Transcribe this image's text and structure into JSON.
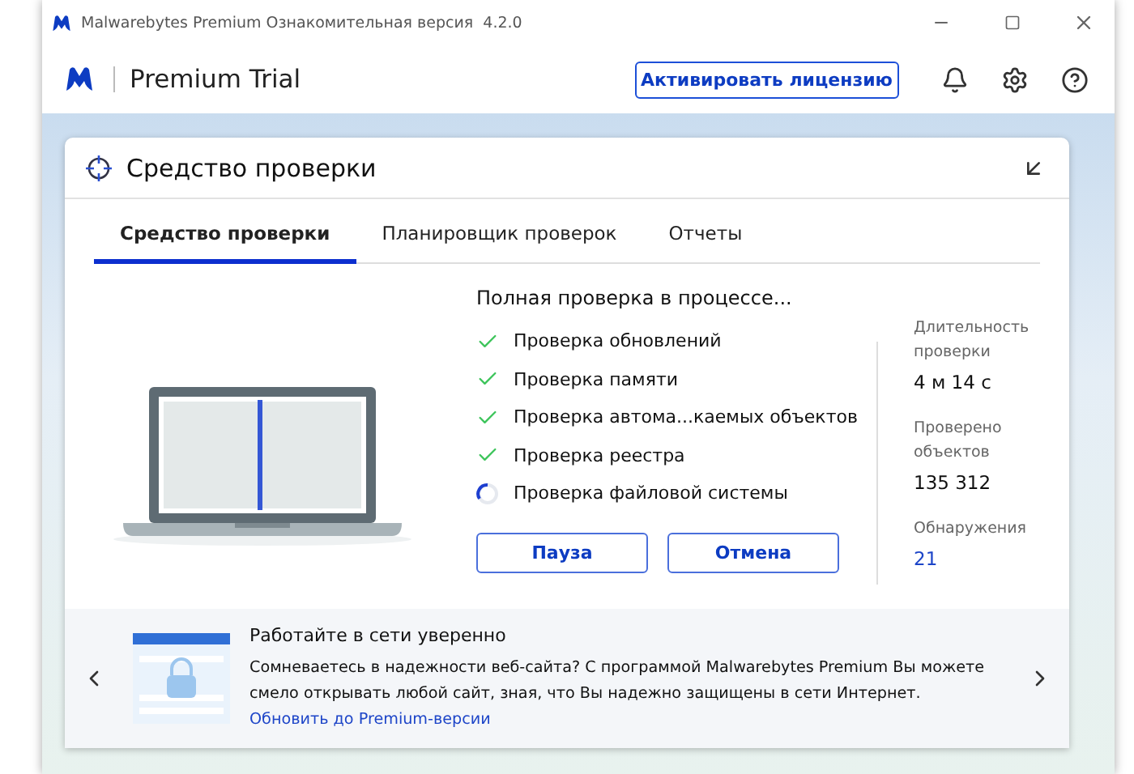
{
  "window": {
    "title": "Malwarebytes Premium Ознакомительная версия  4.2.0"
  },
  "header": {
    "product": "Premium Trial",
    "activate_button": "Активировать лицензию"
  },
  "card": {
    "title": "Средство проверки"
  },
  "tabs": [
    {
      "label": "Средство проверки",
      "selected": true
    },
    {
      "label": "Планировщик проверок",
      "selected": false
    },
    {
      "label": "Отчеты",
      "selected": false
    }
  ],
  "scan": {
    "heading": "Полная проверка в процессе...",
    "steps": [
      {
        "label": "Проверка обновлений",
        "kind": "done"
      },
      {
        "label": "Проверка памяти",
        "kind": "done"
      },
      {
        "label": "Проверка автома...каемых объектов",
        "kind": "done"
      },
      {
        "label": "Проверка реестра",
        "kind": "done"
      },
      {
        "label": "Проверка файловой системы",
        "kind": "running"
      }
    ],
    "buttons": [
      "Пауза",
      "Отмена"
    ]
  },
  "stats": [
    {
      "label": "Длительность проверки",
      "value": "4 м 14 с",
      "highlight": false
    },
    {
      "label": "Проверено объектов",
      "value": "135 312",
      "highlight": false
    },
    {
      "label": "Обнаружения",
      "value": "21",
      "highlight": true
    }
  ],
  "promo": {
    "title": "Работайте в сети уверенно",
    "text": "Сомневаетесь в надежности веб-сайта? С программой Malwarebytes Premium Вы можете смело открывать любой сайт, зная, что Вы надежно защищены в сети Интернет.",
    "link": "Обновить до Premium-версии"
  }
}
